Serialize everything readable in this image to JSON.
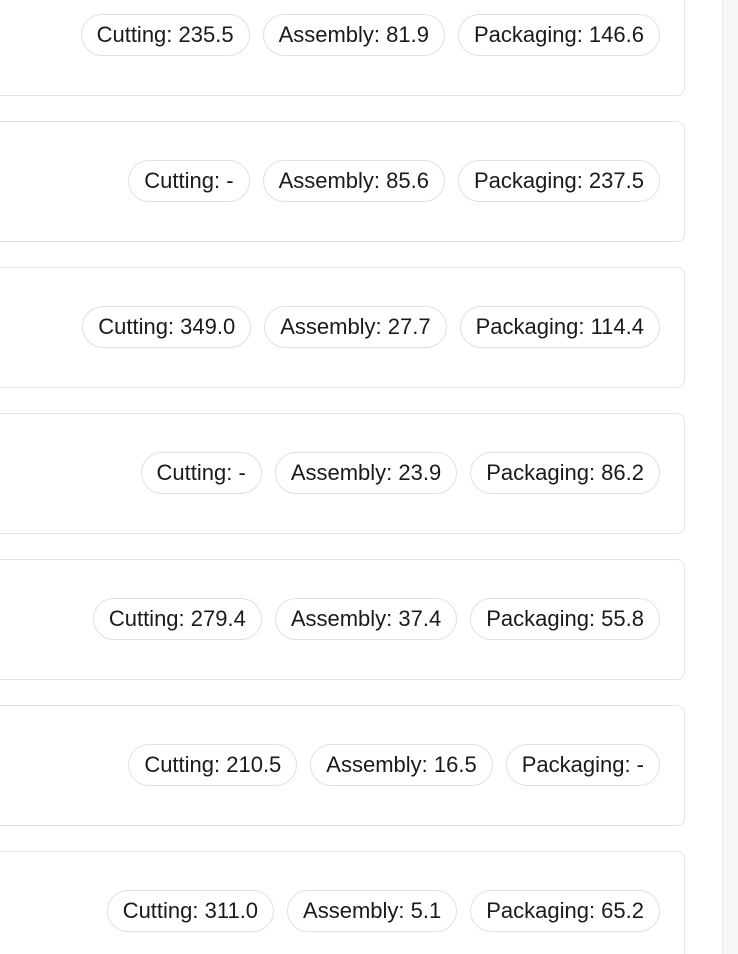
{
  "rows": [
    {
      "chips": [
        "Cutting: 235.5",
        "Assembly: 81.9",
        "Packaging: 146.6"
      ]
    },
    {
      "chips": [
        "Cutting: -",
        "Assembly: 85.6",
        "Packaging: 237.5"
      ]
    },
    {
      "chips": [
        "Cutting: 349.0",
        "Assembly: 27.7",
        "Packaging: 114.4"
      ]
    },
    {
      "chips": [
        "Cutting: -",
        "Assembly: 23.9",
        "Packaging: 86.2"
      ]
    },
    {
      "chips": [
        "Cutting: 279.4",
        "Assembly: 37.4",
        "Packaging: 55.8"
      ]
    },
    {
      "chips": [
        "Cutting: 210.5",
        "Assembly: 16.5",
        "Packaging: -"
      ]
    },
    {
      "chips": [
        "Cutting: 311.0",
        "Assembly: 5.1",
        "Packaging: 65.2"
      ]
    }
  ]
}
